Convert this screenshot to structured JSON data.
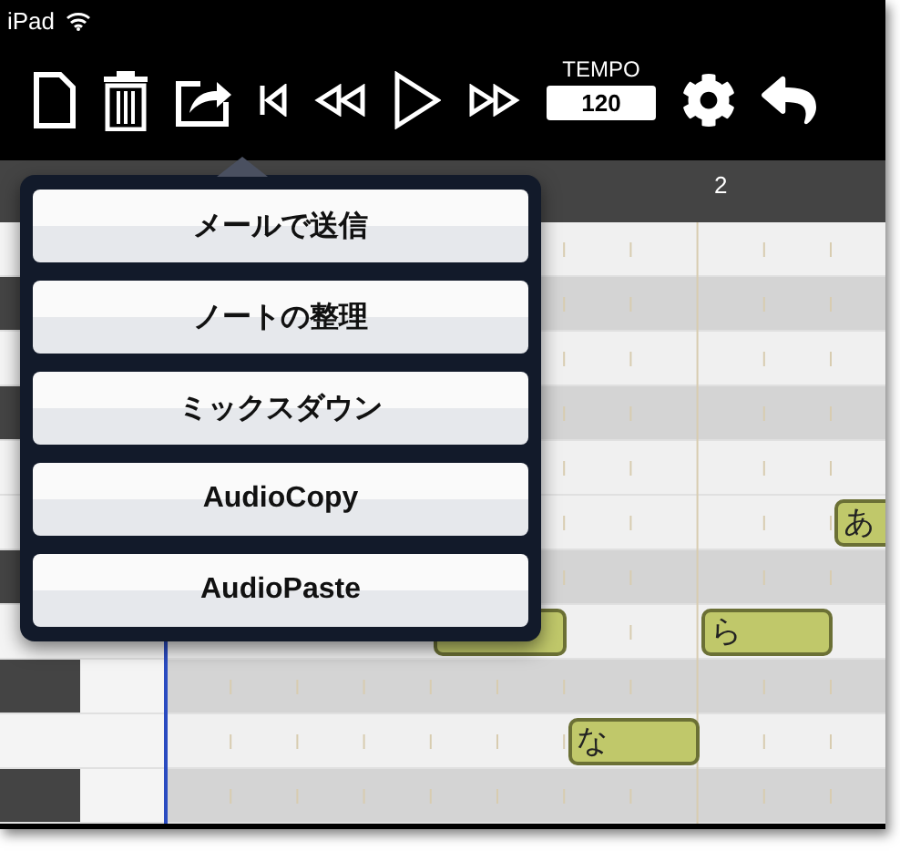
{
  "status_bar": {
    "device": "iPad"
  },
  "toolbar": {
    "tempo_label": "TEMPO",
    "tempo_value": "120"
  },
  "ruler": {
    "bar_label": "2"
  },
  "share_menu": {
    "items": [
      "メールで送信",
      "ノートの整理",
      "ミックスダウン",
      "AudioCopy",
      "AudioPaste"
    ]
  },
  "piano_roll": {
    "rows": [
      {
        "kind": "white"
      },
      {
        "kind": "black"
      },
      {
        "kind": "white"
      },
      {
        "kind": "black"
      },
      {
        "kind": "white"
      },
      {
        "kind": "white"
      },
      {
        "kind": "black"
      },
      {
        "kind": "white"
      },
      {
        "kind": "black"
      },
      {
        "kind": "white"
      },
      {
        "kind": "black"
      }
    ],
    "notes": [
      {
        "kind": "note",
        "lyric": "あ"
      },
      {
        "kind": "note"
      },
      {
        "kind": "note",
        "lyric": "ら"
      },
      {
        "kind": "note",
        "lyric": "な"
      }
    ]
  }
}
